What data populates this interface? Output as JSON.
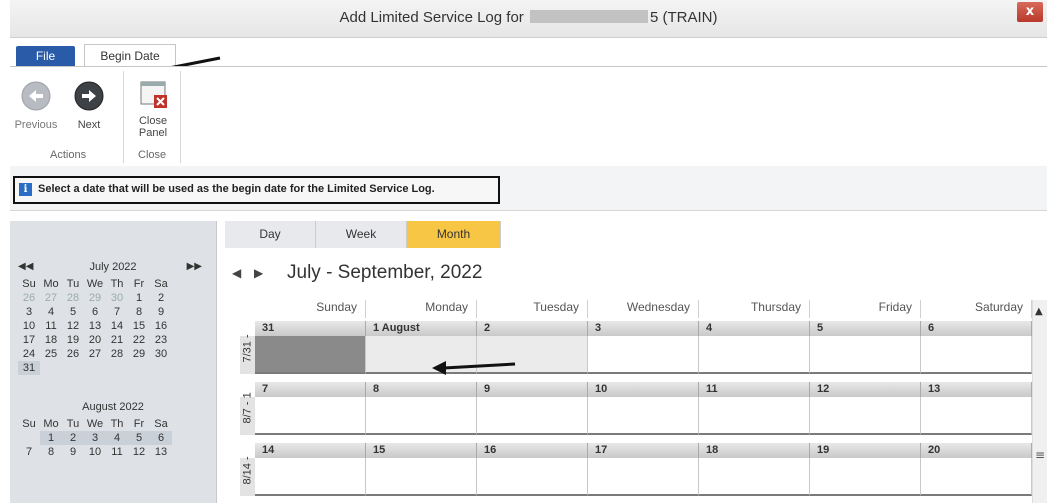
{
  "window": {
    "title_prefix": "Add Limited Service Log for",
    "title_suffix": "5 (TRAIN)",
    "close_label": "x"
  },
  "ribbon": {
    "tabs": [
      {
        "label": "File"
      },
      {
        "label": "Begin Date"
      }
    ],
    "previous_label": "Previous",
    "next_label": "Next",
    "close_panel_label_1": "Close",
    "close_panel_label_2": "Panel",
    "group_actions": "Actions",
    "group_close": "Close"
  },
  "info": {
    "icon": "info-icon",
    "message": "Select a date that will be used as the begin date for the Limited Service Log."
  },
  "mini_calendars": [
    {
      "title": "July 2022",
      "dow": [
        "Su",
        "Mo",
        "Tu",
        "We",
        "Th",
        "Fr",
        "Sa"
      ],
      "weeks": [
        [
          "26",
          "27",
          "28",
          "29",
          "30",
          "1",
          "2"
        ],
        [
          "3",
          "4",
          "5",
          "6",
          "7",
          "8",
          "9"
        ],
        [
          "10",
          "11",
          "12",
          "13",
          "14",
          "15",
          "16"
        ],
        [
          "17",
          "18",
          "19",
          "20",
          "21",
          "22",
          "23"
        ],
        [
          "24",
          "25",
          "26",
          "27",
          "28",
          "29",
          "30"
        ],
        [
          "31",
          "",
          "",
          "",
          "",
          "",
          ""
        ]
      ]
    },
    {
      "title": "August 2022",
      "dow": [
        "Su",
        "Mo",
        "Tu",
        "We",
        "Th",
        "Fr",
        "Sa"
      ],
      "weeks": [
        [
          "",
          "1",
          "2",
          "3",
          "4",
          "5",
          "6"
        ],
        [
          "7",
          "8",
          "9",
          "10",
          "11",
          "12",
          "13"
        ]
      ]
    }
  ],
  "mini_nav": {
    "prev": "◀◀",
    "next": "▶▶"
  },
  "views": [
    "Day",
    "Week",
    "Month"
  ],
  "active_view": "Month",
  "calendar": {
    "range_title": "July - September, 2022",
    "prev_arrow": "◀",
    "next_arrow": "▶",
    "days_of_week": [
      "Sunday",
      "Monday",
      "Tuesday",
      "Wednesday",
      "Thursday",
      "Friday",
      "Saturday"
    ],
    "weeks": [
      {
        "label": "7/31 -",
        "days": [
          "31",
          "1 August",
          "2",
          "3",
          "4",
          "5",
          "6"
        ]
      },
      {
        "label": "8/7 - 1",
        "days": [
          "7",
          "8",
          "9",
          "10",
          "11",
          "12",
          "13"
        ]
      },
      {
        "label": "8/14 -",
        "days": [
          "14",
          "15",
          "16",
          "17",
          "18",
          "19",
          "20"
        ]
      }
    ]
  },
  "colors": {
    "file_tab": "#2a5ba8",
    "active_view": "#f7c645",
    "selected_day": "#8a8a8a"
  }
}
